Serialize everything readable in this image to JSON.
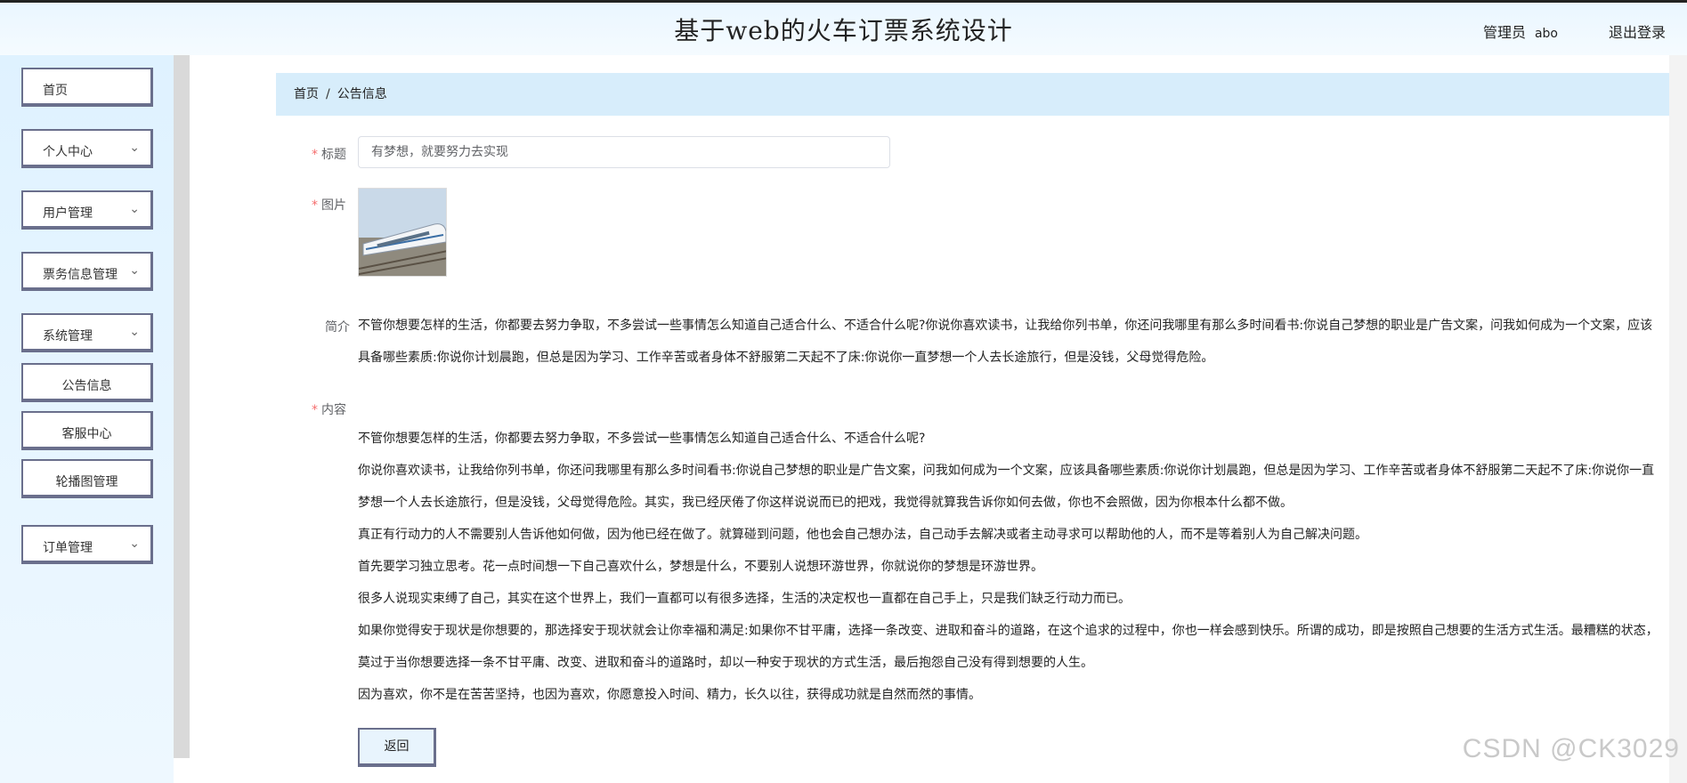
{
  "header": {
    "title": "基于web的火车订票系统设计",
    "user_role": "管理员",
    "user_name": "abo",
    "logout_label": "退出登录"
  },
  "sidebar": {
    "items": [
      {
        "label": "首页",
        "chevron": false
      },
      {
        "label": "个人中心",
        "chevron": true
      },
      {
        "label": "用户管理",
        "chevron": true
      },
      {
        "label": "票务信息管理",
        "chevron": true
      },
      {
        "label": "系统管理",
        "chevron": true
      },
      {
        "label": "公告信息",
        "chevron": false
      },
      {
        "label": "客服中心",
        "chevron": false
      },
      {
        "label": "轮播图管理",
        "chevron": false
      },
      {
        "label": "订单管理",
        "chevron": true
      }
    ],
    "chevron_icon": "chevron-down-icon"
  },
  "breadcrumb": {
    "home": "首页",
    "separator": "/",
    "current": "公告信息"
  },
  "form": {
    "title_label": "标题",
    "title_value": "有梦想，就要努力去实现",
    "image_label": "图片",
    "intro_label": "简介",
    "intro_text": "不管你想要怎样的生活，你都要去努力争取，不多尝试一些事情怎么知道自己适合什么、不适合什么呢?你说你喜欢读书，让我给你列书单，你还问我哪里有那么多时间看书:你说自己梦想的职业是广告文案，问我如何成为一个文案，应该具备哪些素质:你说你计划晨跑，但总是因为学习、工作辛苦或者身体不舒服第二天起不了床:你说你一直梦想一个人去长途旅行，但是没钱，父母觉得危险。",
    "content_label": "内容",
    "content_paragraphs": [
      "不管你想要怎样的生活，你都要去努力争取，不多尝试一些事情怎么知道自己适合什么、不适合什么呢?",
      "你说你喜欢读书，让我给你列书单，你还问我哪里有那么多时间看书:你说自己梦想的职业是广告文案，问我如何成为一个文案，应该具备哪些素质:你说你计划晨跑，但总是因为学习、工作辛苦或者身体不舒服第二天起不了床:你说你一直梦想一个人去长途旅行，但是没钱，父母觉得危险。其实，我已经厌倦了你这样说说而已的把戏，我觉得就算我告诉你如何去做，你也不会照做，因为你根本什么都不做。",
      "真正有行动力的人不需要别人告诉他如何做，因为他已经在做了。就算碰到问题，他也会自己想办法，自己动手去解决或者主动寻求可以帮助他的人，而不是等着别人为自己解决问题。",
      "首先要学习独立思考。花一点时间想一下自己喜欢什么，梦想是什么，不要别人说想环游世界，你就说你的梦想是环游世界。",
      "很多人说现实束缚了自己，其实在这个世界上，我们一直都可以有很多选择，生活的决定权也一直都在自己手上，只是我们缺乏行动力而已。",
      "如果你觉得安于现状是你想要的，那选择安于现状就会让你幸福和满足:如果你不甘平庸，选择一条改变、进取和奋斗的道路，在这个追求的过程中，你也一样会感到快乐。所谓的成功，即是按照自己想要的生活方式生活。最糟糕的状态，莫过于当你想要选择一条不甘平庸、改变、进取和奋斗的道路时，却以一种安于现状的方式生活，最后抱怨自己没有得到想要的人生。",
      "因为喜欢，你不是在苦苦坚持，也因为喜欢，你愿意投入时间、精力，长久以往，获得成功就是自然而然的事情。"
    ],
    "back_label": "返回"
  },
  "watermark": "CSDN @CK3029"
}
